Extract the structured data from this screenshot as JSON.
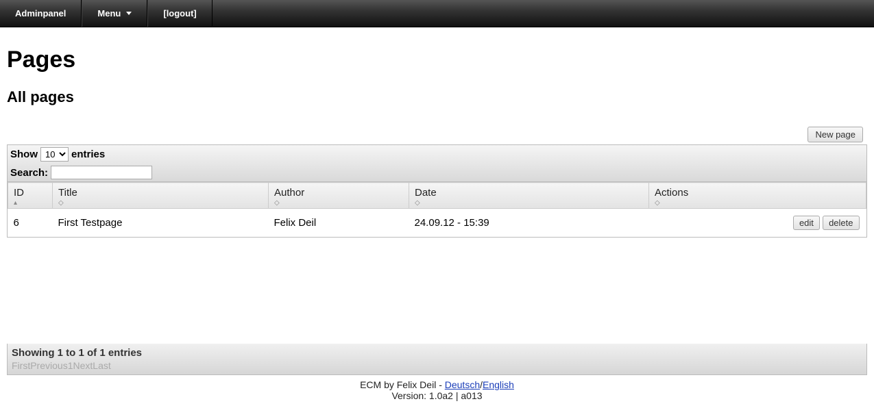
{
  "topbar": {
    "adminpanel": "Adminpanel",
    "menu": "Menu",
    "logout": "[logout]"
  },
  "heading": "Pages",
  "subheading": "All pages",
  "new_page_btn": "New page",
  "controls": {
    "show_prefix": "Show",
    "show_suffix": "entries",
    "show_value": "10",
    "search_label": "Search:"
  },
  "columns": {
    "id": "ID",
    "title": "Title",
    "author": "Author",
    "date": "Date",
    "actions": "Actions"
  },
  "rows": [
    {
      "id": "6",
      "title": "First Testpage",
      "author": "Felix Deil",
      "date": "24.09.12 - 15:39"
    }
  ],
  "row_actions": {
    "edit": "edit",
    "delete": "delete"
  },
  "footer": {
    "status": "Showing 1 to 1 of 1 entries",
    "first": "First",
    "previous": "Previous",
    "page": "1",
    "next": "Next",
    "last": "Last"
  },
  "credits": {
    "line1_prefix": "ECM by Felix Deil - ",
    "deutsch": "Deutsch",
    "sep": "/",
    "english": "English",
    "line2": "Version: 1.0a2 | a013"
  }
}
